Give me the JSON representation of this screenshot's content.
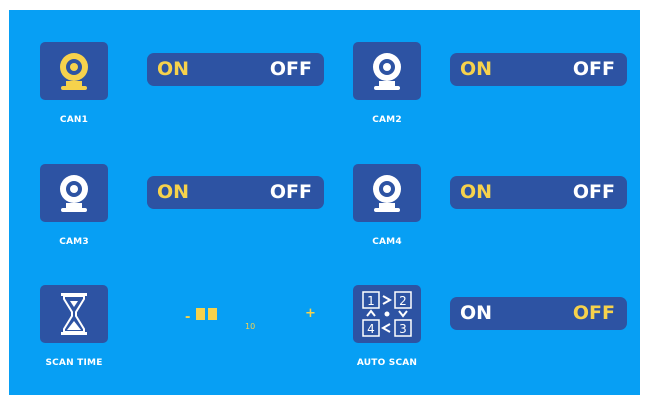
{
  "cameras": [
    {
      "label": "CAN1",
      "on_label": "ON",
      "off_label": "OFF",
      "state": "on",
      "icon": "webcam-icon",
      "icon_color": "#f6d24c"
    },
    {
      "label": "CAM2",
      "on_label": "ON",
      "off_label": "OFF",
      "state": "on",
      "icon": "webcam-icon",
      "icon_color": "#ffffff"
    },
    {
      "label": "CAM3",
      "on_label": "ON",
      "off_label": "OFF",
      "state": "on",
      "icon": "webcam-icon",
      "icon_color": "#ffffff"
    },
    {
      "label": "CAM4",
      "on_label": "ON",
      "off_label": "OFF",
      "state": "on",
      "icon": "webcam-icon",
      "icon_color": "#ffffff"
    }
  ],
  "scan_time": {
    "label": "SCAN TIME",
    "icon": "hourglass-icon",
    "decrease_label": "-",
    "increase_label": "+",
    "value": "10"
  },
  "auto_scan": {
    "label": "AUTO SCAN",
    "icon": "camera-sequence-icon",
    "icon_digits": [
      "1",
      "2",
      "4",
      "3"
    ],
    "on_label": "ON",
    "off_label": "OFF",
    "state": "off"
  },
  "colors": {
    "background": "#079ff4",
    "panel": "#2d53a3",
    "accent": "#f6d24c",
    "text": "#ffffff"
  }
}
